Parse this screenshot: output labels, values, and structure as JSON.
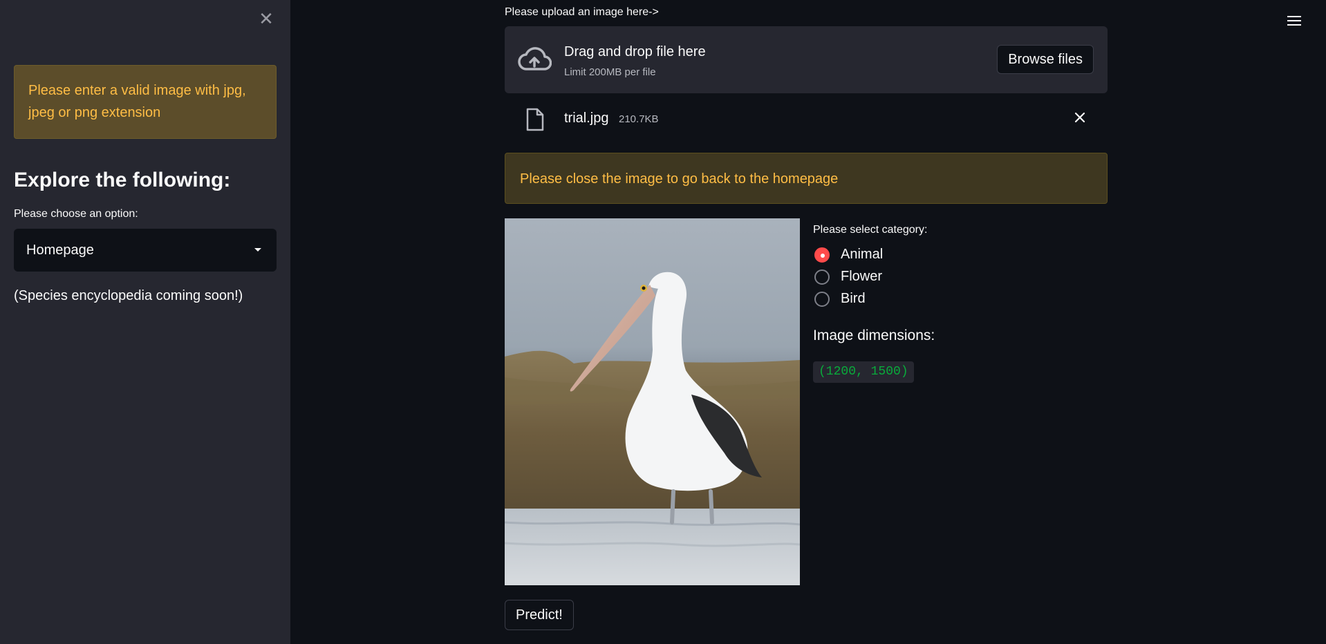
{
  "sidebar": {
    "warning": "Please enter a valid image with jpg, jpeg or png extension",
    "heading": "Explore the following:",
    "select_label": "Please choose an option:",
    "select_value": "Homepage",
    "note": "(Species encyclopedia coming soon!)",
    "close_icon": "close-icon"
  },
  "header": {
    "menu_icon": "hamburger-menu-icon"
  },
  "uploader": {
    "label": "Please upload an image here->",
    "dropzone_title": "Drag and drop file here",
    "dropzone_limit": "Limit 200MB per file",
    "browse_label": "Browse files",
    "icon": "cloud-upload-icon"
  },
  "file": {
    "name": "trial.jpg",
    "size": "210.7KB",
    "icon": "file-icon",
    "remove_icon": "close-icon"
  },
  "main_warning": "Please close the image to go back to the homepage",
  "category": {
    "label": "Please select category:",
    "options": [
      "Animal",
      "Flower",
      "Bird"
    ],
    "selected": "Animal"
  },
  "dimensions": {
    "label": "Image dimensions:",
    "value": "(1200, 1500)"
  },
  "predict_label": "Predict!",
  "colors": {
    "accent": "#ff4b4b",
    "warning_text": "#ffbd45",
    "code_green": "#09ab3b",
    "background": "#0e1117",
    "sidebar": "#262730"
  }
}
